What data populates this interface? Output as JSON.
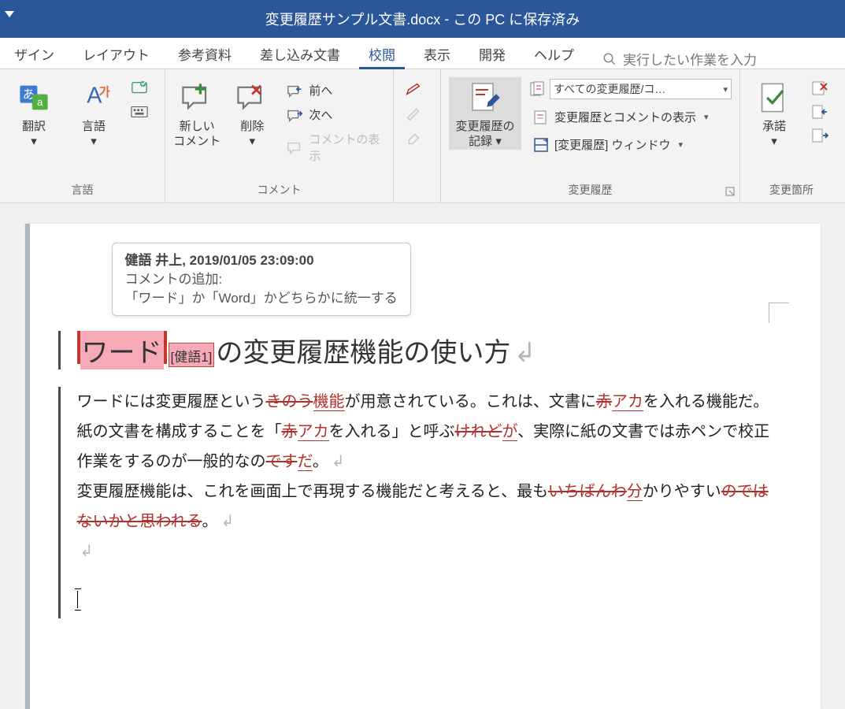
{
  "titlebar": {
    "filename": "変更履歴サンプル文書.docx",
    "save_state": "この PC に保存済み"
  },
  "tabs": {
    "items": [
      "ザイン",
      "レイアウト",
      "参考資料",
      "差し込み文書",
      "校閲",
      "表示",
      "開発",
      "ヘルプ"
    ],
    "active_index": 4,
    "search_placeholder": "実行したい作業を入力"
  },
  "ribbon": {
    "language": {
      "translate": "翻訳",
      "lang": "言語",
      "group_label": "言語"
    },
    "comments": {
      "new_comment": "新しい\nコメント",
      "delete": "削除",
      "previous": "前へ",
      "next": "次へ",
      "show_comments": "コメントの表示",
      "group_label": "コメント"
    },
    "ink": {
      "pen": "",
      "pencil": "",
      "eraser": ""
    },
    "tracking": {
      "track_changes": "変更履歴の\n記録",
      "display_mode": "すべての変更履歴/コ…",
      "show_markup": "変更履歴とコメントの表示",
      "reviewing_pane": "[変更履歴] ウィンドウ",
      "group_label": "変更履歴"
    },
    "changes": {
      "accept": "承諾",
      "group_label": "変更箇所"
    }
  },
  "tooltip": {
    "author_date": "健語 井上, 2019/01/05 23:09:00",
    "label": "コメントの追加:",
    "text": "「ワード」か「Word」かどちらかに統一する"
  },
  "document": {
    "heading_highlight": "ワード",
    "comment_ref": "[健語1]",
    "heading_rest": "の変更履歴機能の使い方",
    "paragraph_mark": "↲",
    "body": {
      "p1_s1": "ワードには変更履歴という",
      "p1_del1": "きのう",
      "p1_ins1": "機能",
      "p1_s2": "が用意されている。これは、文書に",
      "p1_del2": "赤",
      "p1_ins2": "アカ",
      "p1_s3": "を入れる機能だ。紙の文書を構成することを「",
      "p1_del3": "赤",
      "p1_ins3": "アカ",
      "p1_s4": "を入れる」と呼ぶ",
      "p1_del4": "けれど",
      "p1_ins4": "が",
      "p1_s5": "、実際に紙の文書では赤ペンで校正作業をするのが一般的なの",
      "p1_del5": "です",
      "p1_ins5": "だ",
      "p1_s6": "。",
      "p2_s1": "変更履歴機能は、これを画面上で再現する機能だと考えると、最も",
      "p2_del1": "いちばんわ",
      "p2_ins1": "分",
      "p2_s2": "かりやすい",
      "p2_del2": "のではないかと思われる",
      "p2_s3": "。"
    }
  }
}
